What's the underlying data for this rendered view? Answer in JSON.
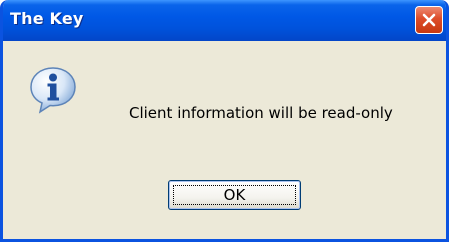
{
  "dialog": {
    "title": "The Key",
    "icon": "information-icon",
    "message": "Client information will be read-only",
    "ok_label": "OK",
    "close_icon": "close-icon"
  },
  "colors": {
    "titlebar": "#0058e6",
    "window_border": "#0b53e0",
    "body": "#ece9d8",
    "close_button": "#dd4c29",
    "button_border": "#003c74"
  }
}
